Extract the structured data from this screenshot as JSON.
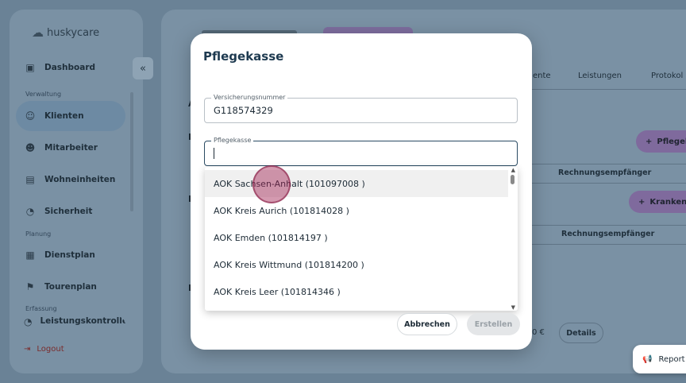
{
  "app": {
    "logo_text": "huskycare"
  },
  "sidebar": {
    "collapse_glyph": "«",
    "sections": {
      "verwaltung": "Verwaltung",
      "planung": "Planung",
      "erfassung": "Erfassung"
    },
    "items": [
      {
        "label": "Dashboard",
        "icon": "dashboard-icon",
        "glyph": "▣"
      },
      {
        "label": "Klienten",
        "icon": "clients-icon",
        "glyph": "☺",
        "active": true
      },
      {
        "label": "Mitarbeiter",
        "icon": "employees-icon",
        "glyph": "☻"
      },
      {
        "label": "Wohneinheiten",
        "icon": "housing-icon",
        "glyph": "▤"
      },
      {
        "label": "Sicherheit",
        "icon": "security-icon",
        "glyph": "◔"
      },
      {
        "label": "Dienstplan",
        "icon": "calendar-icon",
        "glyph": "▦"
      },
      {
        "label": "Tourenplan",
        "icon": "flag-icon",
        "glyph": "⚑"
      },
      {
        "label": "Leistungskontrolle",
        "icon": "control-icon",
        "glyph": "◔"
      }
    ],
    "logout": {
      "label": "Logout",
      "icon": "logout-icon",
      "glyph": "⇥"
    }
  },
  "background": {
    "tabs": [
      "ente",
      "Leistungen",
      "Protokol"
    ],
    "buttons": [
      {
        "label": "Pflegek",
        "glyph": "+"
      },
      {
        "label": "Krankenk",
        "glyph": "+"
      }
    ],
    "column_header": "Rechnungsempfänger",
    "amount_fragment": "0 €",
    "details_label": "Details",
    "report_label": "Report a",
    "left_letters": [
      "A",
      "P",
      "K",
      "L"
    ]
  },
  "modal": {
    "title": "Pflegekasse",
    "insurance_number": {
      "label": "Versicherungsnummer",
      "value": "G118574329"
    },
    "care_fund": {
      "label": "Pflegekasse",
      "value": ""
    },
    "options": [
      "AOK Sachsen-Anhalt (101097008 )",
      "AOK Kreis Aurich (101814028 )",
      "AOK Emden (101814197 )",
      "AOK Kreis Wittmund (101814200 )",
      "AOK Kreis Leer (101814346 )"
    ],
    "cancel_label": "Abbrechen",
    "create_label": "Erstellen"
  },
  "colors": {
    "modal_title": "#1e3a50",
    "click_marker": "#a01e50",
    "accent_purple": "#7f6a9d"
  }
}
